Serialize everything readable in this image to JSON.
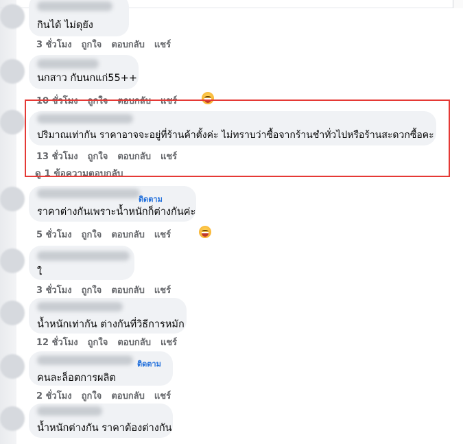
{
  "comments": [
    {
      "text": "กินได้ ไม่ดุยัง",
      "time": "3 ชั่วโมง",
      "like": "ถูกใจ",
      "reply": "ตอบกลับ",
      "share": "แชร์"
    },
    {
      "text": "นกสาว กับนกแก่55++",
      "time": "10 ชั่วโมง",
      "like": "ถูกใจ",
      "reply": "ตอบกลับ",
      "share": "แชร์",
      "reaction": "laughing-emoji"
    },
    {
      "text": "ปริมาณเท่ากัน ราคาอาจจะอยู่ที่ร้านค้าตั้งค่ะ ไม่ทราบว่าซื้อจากร้านชำทั่วไปหรือร้านสะดวกซื้อคะ",
      "time": "13 ชั่วโมง",
      "like": "ถูกใจ",
      "reply": "ตอบกลับ",
      "share": "แชร์",
      "replies": "ดู 1 ข้อความตอบกลับ",
      "highlighted": true
    },
    {
      "text": "ราคาต่างกันเพราะน้ำหนักก็ต่างกันค่ะ",
      "follow": "ติดตาม",
      "time": "5 ชั่วโมง",
      "like": "ถูกใจ",
      "reply": "ตอบกลับ",
      "share": "แชร์",
      "reaction": "laughing-emoji"
    },
    {
      "text": "ใ",
      "time": "3 ชั่วโมง",
      "like": "ถูกใจ",
      "reply": "ตอบกลับ",
      "share": "แชร์"
    },
    {
      "text": "น้ำหนักเท่ากัน ต่างกันที่วิธีการหมัก",
      "time": "12 ชั่วโมง",
      "like": "ถูกใจ",
      "reply": "ตอบกลับ",
      "share": "แชร์"
    },
    {
      "text": "คนละล็อตการผลิต",
      "follow": "ติดตาม",
      "time": "2 ชั่วโมง",
      "like": "ถูกใจ",
      "reply": "ตอบกลับ",
      "share": "แชร์"
    },
    {
      "text": "น้ำหนักต่างกัน ราคาต้องต่างกัน",
      "time": "",
      "like": "",
      "reply": "",
      "share": ""
    }
  ],
  "colors": {
    "highlight": "#e53935",
    "bubble": "#f0f2f5",
    "link": "#216fdb",
    "meta": "#65676b"
  }
}
